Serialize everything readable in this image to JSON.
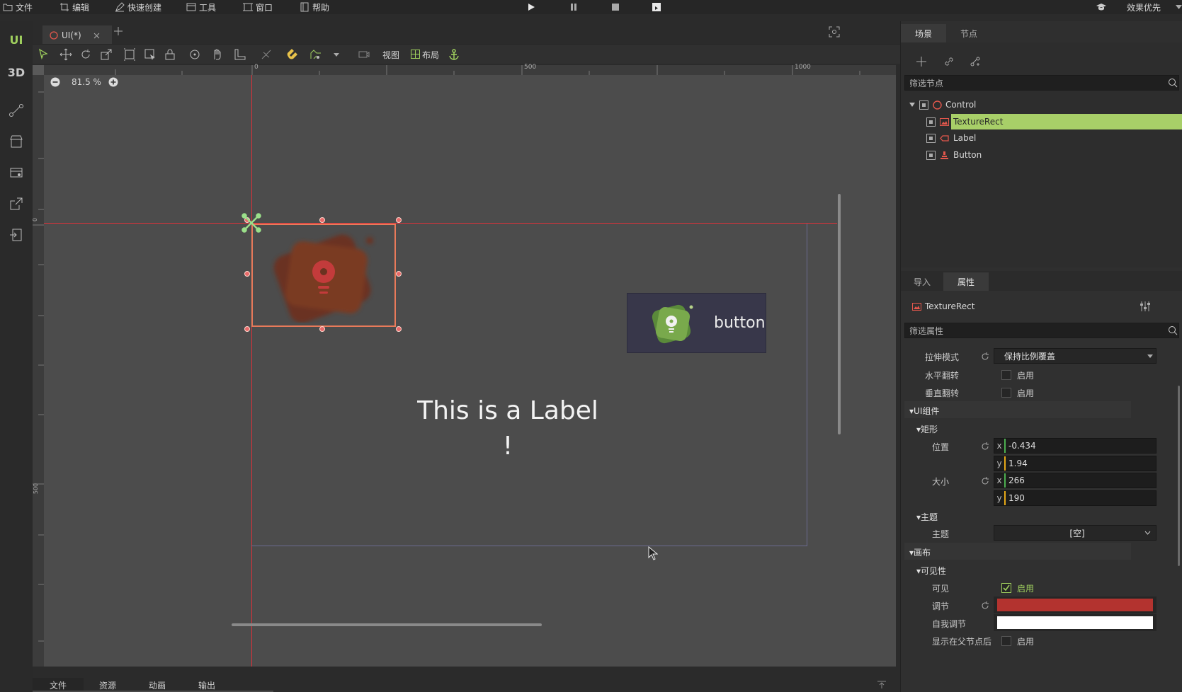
{
  "menu": {
    "file": "文件",
    "edit": "编辑",
    "quick_create": "快速创建",
    "tools": "工具",
    "window": "窗口",
    "help": "帮助",
    "quality": "效果优先"
  },
  "left_bar": {
    "ui": "UI",
    "three_d": "3D"
  },
  "document_tab": {
    "label": "UI(*)"
  },
  "toolbar": {
    "view": "视图",
    "layout": "布局"
  },
  "zoom": {
    "level": "81.5 %"
  },
  "rulers": {
    "h_ticks": [
      "0",
      "500",
      "1000"
    ],
    "v_ticks": [
      "0",
      "500"
    ]
  },
  "canvas": {
    "label_text_line1": "This is a Label",
    "label_text_line2": "!",
    "button_text": "button"
  },
  "bottom_tabs": [
    "文件",
    "资源",
    "动画",
    "输出"
  ],
  "scene_panel": {
    "tab_scene": "场景",
    "tab_node": "节点",
    "filter_placeholder": "筛选节点",
    "tree": [
      {
        "name": "Control",
        "icon": "control-icon"
      },
      {
        "name": "TextureRect",
        "icon": "texture-rect-icon",
        "selected": true
      },
      {
        "name": "Label",
        "icon": "label-icon"
      },
      {
        "name": "Button",
        "icon": "button-node-icon"
      }
    ]
  },
  "inspector": {
    "tab_import": "导入",
    "tab_properties": "属性",
    "node_type": "TextureRect",
    "filter_placeholder": "筛选属性",
    "stretch_mode_label": "拉伸模式",
    "stretch_mode_value": "保持比例覆盖",
    "flip_h_label": "水平翻转",
    "flip_v_label": "垂直翻转",
    "enable": "启用",
    "section_ui": "UI组件",
    "section_rect": "矩形",
    "position_label": "位置",
    "position_x": "-0.434",
    "position_y": "1.94",
    "size_label": "大小",
    "size_x": "266",
    "size_y": "190",
    "section_theme": "主题",
    "theme_label": "主题",
    "theme_value": "[空]",
    "section_canvas": "画布",
    "section_visibility": "可见性",
    "visible_label": "可见",
    "modulate_label": "调节",
    "self_modulate_label": "自我调节",
    "show_behind_parent_label": "显示在父节点后",
    "modulate_color": "#b3332f",
    "self_modulate_color": "#ffffff"
  },
  "colors": {
    "accent_green": "#9fcf5e",
    "selection_red": "#e2574c"
  }
}
